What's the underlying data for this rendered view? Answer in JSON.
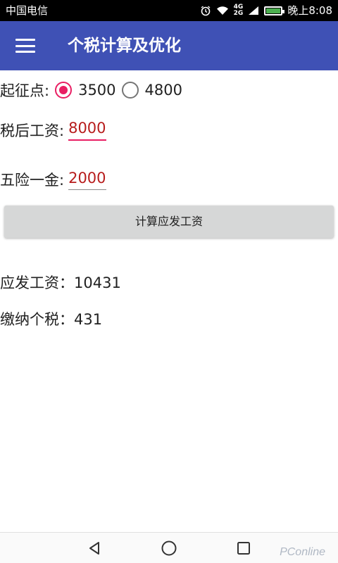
{
  "status_bar": {
    "carrier": "中国电信",
    "signal_top": "4G",
    "signal_bottom": "2G",
    "time": "晚上8:08"
  },
  "app_bar": {
    "title": "个税计算及优化",
    "menu_icon": "hamburger-menu-icon"
  },
  "threshold": {
    "label": "起征点:",
    "options": [
      {
        "label": "3500",
        "selected": true
      },
      {
        "label": "4800",
        "selected": false
      }
    ]
  },
  "after_tax_salary": {
    "label": "税后工资:",
    "value": "8000"
  },
  "insurance": {
    "label": "五险一金:",
    "value": "2000"
  },
  "calculate_button": {
    "label": "计算应发工资"
  },
  "results": {
    "gross_salary": "应发工资：10431",
    "tax_paid": "缴纳个税：431"
  },
  "nav_bar": {
    "back_icon": "back-triangle-icon",
    "home_icon": "home-circle-icon",
    "recent_icon": "recent-apps-square-icon"
  },
  "watermark": "PConline",
  "colors": {
    "app_bar": "#3f51b5",
    "accent": "#e91e63",
    "field_value": "#b71c1c",
    "button_bg": "#d6d7d7"
  }
}
